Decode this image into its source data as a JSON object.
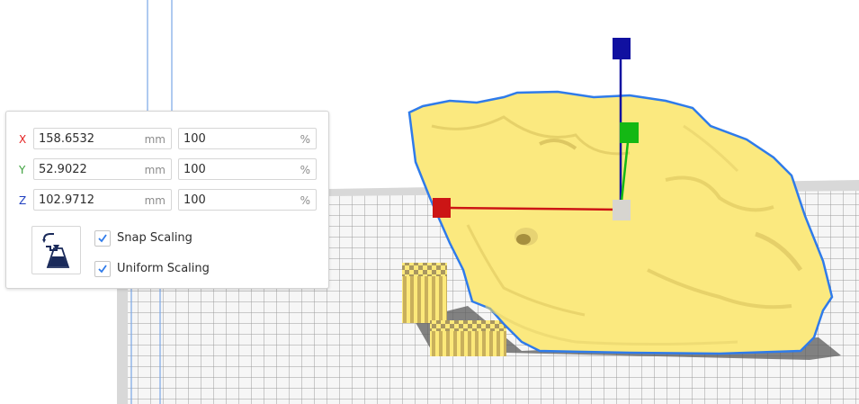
{
  "scale_panel": {
    "rows": [
      {
        "axis": "X",
        "axis_color": "#e42020",
        "mm_value": "158.6532",
        "mm_unit": "mm",
        "pct_value": "100",
        "pct_unit": "%"
      },
      {
        "axis": "Y",
        "axis_color": "#3ca03c",
        "mm_value": "52.9022",
        "mm_unit": "mm",
        "pct_value": "100",
        "pct_unit": "%"
      },
      {
        "axis": "Z",
        "axis_color": "#2040c0",
        "mm_value": "102.9712",
        "mm_unit": "mm",
        "pct_value": "100",
        "pct_unit": "%"
      }
    ],
    "lay_flat_icon": "lay-flat-icon",
    "snap_scaling": {
      "label": "Snap Scaling",
      "checked": true
    },
    "uniform_scaling": {
      "label": "Uniform Scaling",
      "checked": true
    }
  },
  "viewport": {
    "model_color": "#fbe97f",
    "selection_outline_color": "#2f7bea",
    "gizmo": {
      "x_color": "#cc1515",
      "y_color": "#14b814",
      "z_color": "#1010a0",
      "center_color": "#d7d5d0"
    },
    "build_plate_color": "#f4f4f4",
    "grid_line_color": "#9a9a9a"
  }
}
